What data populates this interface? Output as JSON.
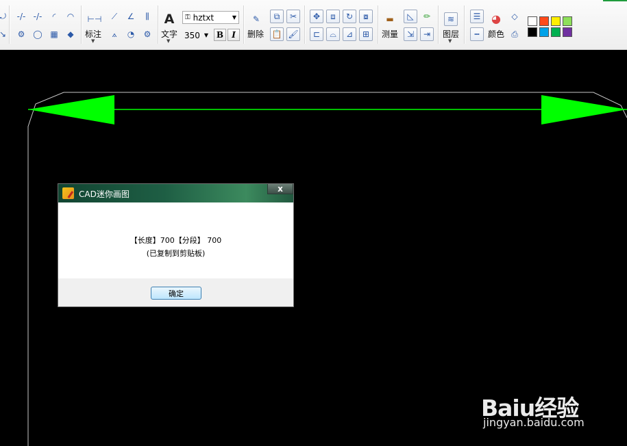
{
  "toolbar": {
    "dimension_label": "标注",
    "text_label": "文字",
    "font_name": "hztxt",
    "font_size": "350",
    "bold_label": "B",
    "italic_label": "I",
    "delete_label": "删除",
    "measure_label": "测量",
    "layer_label": "图层",
    "color_label": "颜色",
    "palette": [
      "#ffffff",
      "#ff4a1a",
      "#ffee00",
      "#8ee05a",
      "#000000",
      "#00a2e8",
      "#00b050",
      "#7030a0"
    ]
  },
  "canvas": {
    "line_color": "#00ff00",
    "outline_color": "#c8c8c8"
  },
  "dialog": {
    "title": "CAD迷你画图",
    "close_label": "x",
    "message_line1": "【长度】700【分段】 700",
    "message_line2": "(已复制到剪贴板)",
    "ok_label": "确定"
  },
  "watermark": {
    "logo_text": "Baiu经验",
    "url": "jingyan.baidu.com"
  }
}
